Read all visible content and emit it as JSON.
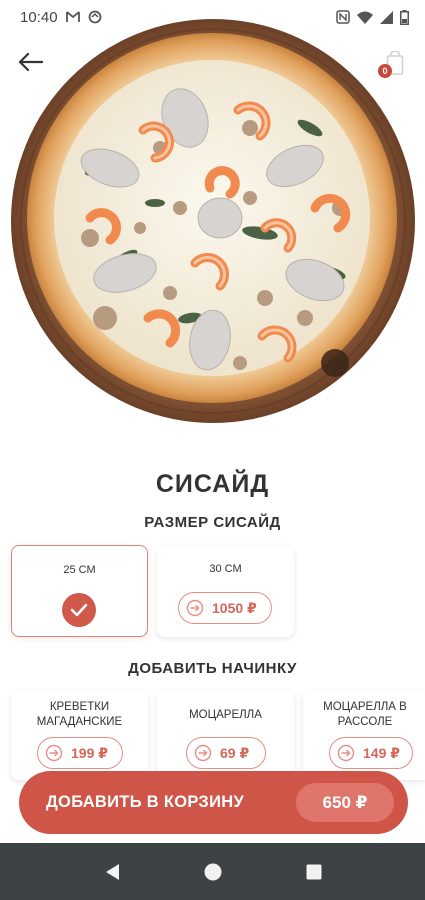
{
  "status_bar": {
    "time": "10:40",
    "left_icons": [
      "gmail-icon",
      "sync-icon"
    ],
    "right_icons": [
      "nfc-icon",
      "wifi-icon",
      "signal-icon",
      "battery-icon"
    ]
  },
  "header": {
    "back_icon": "arrow-left-icon",
    "cart_icon": "cart-icon",
    "cart_count": "0"
  },
  "product": {
    "title": "СИСАЙД",
    "image": "pizza-photo"
  },
  "size_section": {
    "title": "РАЗМЕР СИСАЙД",
    "options": [
      {
        "label": "25 СМ",
        "selected": true
      },
      {
        "label": "30 СМ",
        "price": "1050 ₽",
        "selected": false
      }
    ]
  },
  "toppings_section": {
    "title": "ДОБАВИТЬ НАЧИНКУ",
    "items": [
      {
        "name": "КРЕВЕТКИ МАГАДАНСКИЕ",
        "price": "199 ₽"
      },
      {
        "name": "МОЦАРЕЛЛА",
        "price": "69 ₽"
      },
      {
        "name": "МОЦАРЕЛЛА В РАССОЛЕ",
        "price": "149 ₽"
      }
    ]
  },
  "add_to_cart": {
    "label": "ДОБАВИТЬ В КОРЗИНУ",
    "price": "650 ₽"
  },
  "nav": {
    "back_icon": "nav-back-icon",
    "home_icon": "nav-home-icon",
    "recents_icon": "nav-recents-icon"
  },
  "colors": {
    "accent": "#cf5548",
    "accent_light": "#e0766b",
    "pill_border": "#e58f84",
    "nav_bar": "#3d4345"
  }
}
